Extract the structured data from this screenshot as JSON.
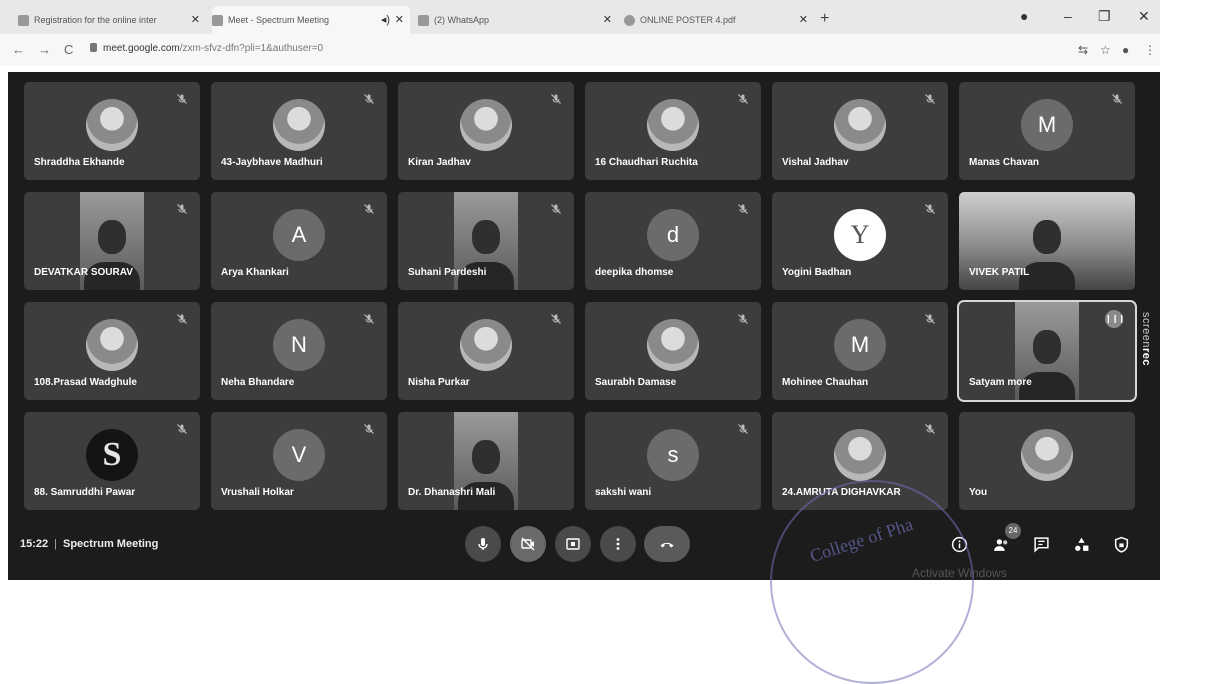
{
  "browser": {
    "tabs": [
      {
        "title": "Registration for the online inter",
        "active": false
      },
      {
        "title": "Meet - Spectrum Meeting",
        "active": true
      },
      {
        "title": "(2) WhatsApp",
        "active": false
      },
      {
        "title": "ONLINE POSTER 4.pdf",
        "active": false
      }
    ],
    "url_host": "meet.google.com",
    "url_path": "/zxm-sfvz-dfn?pli=1&authuser=0"
  },
  "meeting": {
    "time": "15:22",
    "separator": "|",
    "name": "Spectrum Meeting",
    "participant_count": "24"
  },
  "participants": [
    {
      "name": "Shraddha Ekhande",
      "avatar": "photo",
      "muted": true
    },
    {
      "name": "43-Jaybhave Madhuri",
      "avatar": "photo",
      "muted": true
    },
    {
      "name": "Kiran Jadhav",
      "avatar": "photo",
      "muted": true
    },
    {
      "name": "16 Chaudhari Ruchita",
      "avatar": "photo",
      "muted": true
    },
    {
      "name": "Vishal Jadhav",
      "avatar": "photo",
      "muted": true
    },
    {
      "name": "Manas Chavan",
      "avatar": "letter",
      "letter": "M",
      "muted": true
    },
    {
      "name": "DEVATKAR SOURAV",
      "avatar": "video",
      "muted": true
    },
    {
      "name": "Arya Khankari",
      "avatar": "letter",
      "letter": "A",
      "muted": true
    },
    {
      "name": "Suhani Pardeshi",
      "avatar": "video",
      "muted": true
    },
    {
      "name": "deepika dhomse",
      "avatar": "letter",
      "letter": "d",
      "muted": true
    },
    {
      "name": "Yogini Badhan",
      "avatar": "logo",
      "letter": "Y",
      "muted": true
    },
    {
      "name": "VIVEK PATIL",
      "avatar": "video-wide",
      "muted": true
    },
    {
      "name": "108.Prasad Wadghule",
      "avatar": "photo",
      "muted": true
    },
    {
      "name": "Neha Bhandare",
      "avatar": "letter",
      "letter": "N",
      "muted": true
    },
    {
      "name": "Nisha Purkar",
      "avatar": "photo",
      "muted": true
    },
    {
      "name": "Saurabh Damase",
      "avatar": "photo",
      "muted": true
    },
    {
      "name": "Mohinee Chauhan",
      "avatar": "letter",
      "letter": "M",
      "muted": true
    },
    {
      "name": "Satyam more",
      "avatar": "video",
      "muted": false,
      "speaking": true
    },
    {
      "name": "88. Samruddhi Pawar",
      "avatar": "slogo",
      "letter": "S",
      "muted": true
    },
    {
      "name": "Vrushali Holkar",
      "avatar": "letter",
      "letter": "V",
      "muted": true
    },
    {
      "name": "Dr. Dhanashri Mali",
      "avatar": "video",
      "muted": false
    },
    {
      "name": "sakshi wani",
      "avatar": "letter",
      "letter": "s",
      "muted": true
    },
    {
      "name": "24.AMRUTA DIGHAVKAR",
      "avatar": "photo",
      "muted": true
    },
    {
      "name": "You",
      "avatar": "photo",
      "muted": false
    }
  ],
  "watermark": {
    "prefix": "screen",
    "bold": "rec"
  },
  "os_overlay": "Activate Windows",
  "stamp_text": "College of Pha"
}
